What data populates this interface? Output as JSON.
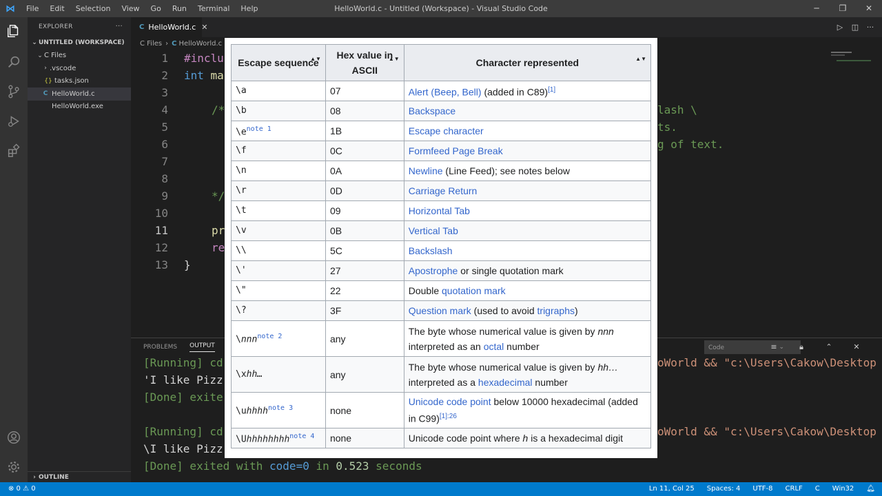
{
  "titlebar": {
    "logo": "⋈",
    "menu": [
      "File",
      "Edit",
      "Selection",
      "View",
      "Go",
      "Run",
      "Terminal",
      "Help"
    ],
    "title": "HelloWorld.c - Untitled (Workspace) - Visual Studio Code",
    "minimize": "─",
    "maximize": "❐",
    "close": "✕"
  },
  "sidebar": {
    "header": "EXPLORER",
    "more": "···",
    "workspace": "UNTITLED (WORKSPACE)",
    "folder": "C Files",
    "subfolder": ".vscode",
    "tasks_icon": "{}",
    "tasks": "tasks.json",
    "c_icon": "C",
    "file_c": "HelloWorld.c",
    "file_exe": "HelloWorld.exe",
    "outline": "OUTLINE"
  },
  "editor": {
    "tab_icon": "C",
    "tab_label": "HelloWorld.c",
    "tab_close": "✕",
    "breadcrumb": [
      "C Files",
      "HelloWorld.c"
    ],
    "line_numbers": [
      "1",
      "2",
      "3",
      "4",
      "5",
      "6",
      "7",
      "8",
      "9",
      "10",
      "11",
      "12",
      "13"
    ],
    "code": {
      "l1_kw": "#inclu",
      "l2_kw": "int",
      "l2_rest": " ma",
      "l4": "/*",
      "l9": "*/",
      "l11": "pr",
      "l12": "re",
      "l13": "}",
      "right_l4": "lash \\",
      "right_l5": "ts.",
      "right_l6": "g of text."
    }
  },
  "panel": {
    "tabs": [
      "PROBLEMS",
      "OUTPUT"
    ],
    "channel": "Code",
    "lines": {
      "l1_left": "[Running] cd",
      "l1_right": "oWorld && \"c:\\Users\\Cakow\\Desktop",
      "l2_left": "'I like Pizz",
      "l3_left": "[Done] exite",
      "l4_left": "[Running] cd",
      "l4_right": "oWorld && \"c:\\Users\\Cakow\\Desktop",
      "l5_left": "\\I like Pizz",
      "l6_a": "[Done] exited with ",
      "l6_code": "code=0",
      "l6_b": " in ",
      "l6_num": "0.523",
      "l6_c": " seconds"
    }
  },
  "statusbar": {
    "left": "⊗ 0 ⚠ 0",
    "right": [
      "Ln 11, Col 25",
      "Spaces: 4",
      "UTF-8",
      "CRLF",
      "C",
      "Win32"
    ]
  },
  "table": {
    "sort_glyph": "▲▼",
    "headers": [
      "Escape sequence",
      "Hex value in ASCII",
      "Character represented"
    ],
    "rows": [
      {
        "seq": "\\a",
        "hex": "07",
        "link": "Alert (Beep, Bell)",
        "after": " (added in C89)",
        "sup": "[1]"
      },
      {
        "seq": "\\b",
        "hex": "08",
        "link": "Backspace"
      },
      {
        "seq": "\\e",
        "seq_sup": "note 1",
        "hex": "1B",
        "link": "Escape character"
      },
      {
        "seq": "\\f",
        "hex": "0C",
        "link": "Formfeed Page Break"
      },
      {
        "seq": "\\n",
        "hex": "0A",
        "link": "Newline",
        "after": " (Line Feed); see notes below"
      },
      {
        "seq": "\\r",
        "hex": "0D",
        "link": "Carriage Return"
      },
      {
        "seq": "\\t",
        "hex": "09",
        "link": "Horizontal Tab"
      },
      {
        "seq": "\\v",
        "hex": "0B",
        "link": "Vertical Tab"
      },
      {
        "seq": "\\\\",
        "hex": "5C",
        "link": "Backslash"
      },
      {
        "seq": "\\'",
        "hex": "27",
        "link": "Apostrophe",
        "after": " or single quotation mark"
      },
      {
        "seq": "\\\"",
        "hex": "22",
        "before": "Double ",
        "link": "quotation mark"
      },
      {
        "seq": "\\?",
        "hex": "3F",
        "link": "Question mark",
        "after": " (used to avoid ",
        "link2": "trigraphs",
        "after2": ")"
      },
      {
        "seq": "\\",
        "seq_it": "nnn",
        "seq_sup": "note 2",
        "hex": "any",
        "a": "The byte whose numerical value is given by ",
        "it": "nnn",
        "b": " interpreted as an ",
        "link": "octal",
        "after": " number"
      },
      {
        "seq": "\\x",
        "seq_it": "hh…",
        "hex": "any",
        "a": "The byte whose numerical value is given by ",
        "it": "hh…",
        "b": " interpreted as a ",
        "link": "hexadecimal",
        "after": " number"
      },
      {
        "seq": "\\u",
        "seq_it": "hhhh",
        "seq_sup": "note 3",
        "hex": "none",
        "link": "Unicode code point",
        "after": " below 10000 hexadecimal (added in C99)",
        "sup": "[1]:26"
      },
      {
        "seq": "\\U",
        "seq_it": "hhhhhhhh",
        "seq_sup": "note 4",
        "hex": "none",
        "a": "Unicode code point where ",
        "it": "h",
        "b": " is a hexadecimal digit"
      }
    ]
  }
}
